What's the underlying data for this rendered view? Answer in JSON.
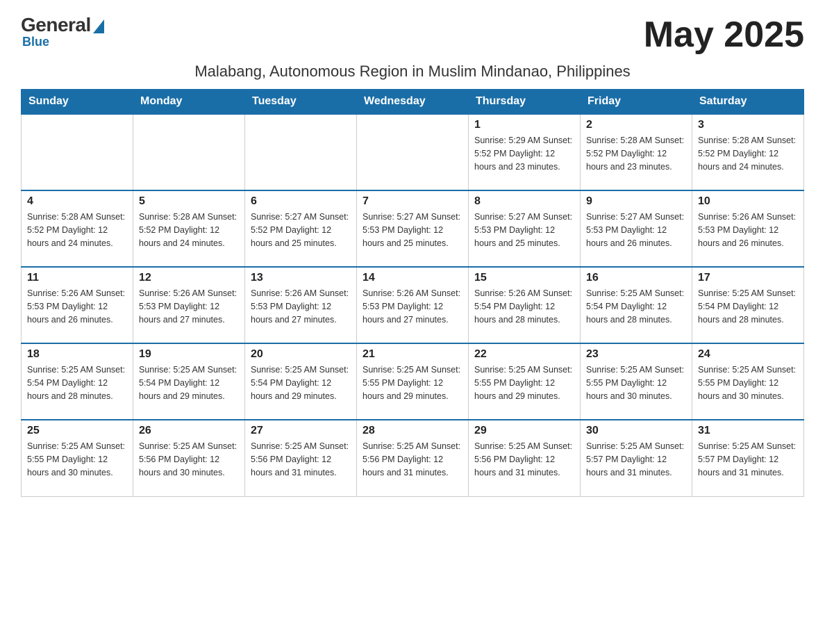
{
  "header": {
    "logo_general": "General",
    "logo_blue": "Blue",
    "month_year": "May 2025",
    "location": "Malabang, Autonomous Region in Muslim Mindanao, Philippines"
  },
  "weekdays": [
    "Sunday",
    "Monday",
    "Tuesday",
    "Wednesday",
    "Thursday",
    "Friday",
    "Saturday"
  ],
  "weeks": [
    [
      {
        "day": "",
        "info": ""
      },
      {
        "day": "",
        "info": ""
      },
      {
        "day": "",
        "info": ""
      },
      {
        "day": "",
        "info": ""
      },
      {
        "day": "1",
        "info": "Sunrise: 5:29 AM\nSunset: 5:52 PM\nDaylight: 12 hours\nand 23 minutes."
      },
      {
        "day": "2",
        "info": "Sunrise: 5:28 AM\nSunset: 5:52 PM\nDaylight: 12 hours\nand 23 minutes."
      },
      {
        "day": "3",
        "info": "Sunrise: 5:28 AM\nSunset: 5:52 PM\nDaylight: 12 hours\nand 24 minutes."
      }
    ],
    [
      {
        "day": "4",
        "info": "Sunrise: 5:28 AM\nSunset: 5:52 PM\nDaylight: 12 hours\nand 24 minutes."
      },
      {
        "day": "5",
        "info": "Sunrise: 5:28 AM\nSunset: 5:52 PM\nDaylight: 12 hours\nand 24 minutes."
      },
      {
        "day": "6",
        "info": "Sunrise: 5:27 AM\nSunset: 5:52 PM\nDaylight: 12 hours\nand 25 minutes."
      },
      {
        "day": "7",
        "info": "Sunrise: 5:27 AM\nSunset: 5:53 PM\nDaylight: 12 hours\nand 25 minutes."
      },
      {
        "day": "8",
        "info": "Sunrise: 5:27 AM\nSunset: 5:53 PM\nDaylight: 12 hours\nand 25 minutes."
      },
      {
        "day": "9",
        "info": "Sunrise: 5:27 AM\nSunset: 5:53 PM\nDaylight: 12 hours\nand 26 minutes."
      },
      {
        "day": "10",
        "info": "Sunrise: 5:26 AM\nSunset: 5:53 PM\nDaylight: 12 hours\nand 26 minutes."
      }
    ],
    [
      {
        "day": "11",
        "info": "Sunrise: 5:26 AM\nSunset: 5:53 PM\nDaylight: 12 hours\nand 26 minutes."
      },
      {
        "day": "12",
        "info": "Sunrise: 5:26 AM\nSunset: 5:53 PM\nDaylight: 12 hours\nand 27 minutes."
      },
      {
        "day": "13",
        "info": "Sunrise: 5:26 AM\nSunset: 5:53 PM\nDaylight: 12 hours\nand 27 minutes."
      },
      {
        "day": "14",
        "info": "Sunrise: 5:26 AM\nSunset: 5:53 PM\nDaylight: 12 hours\nand 27 minutes."
      },
      {
        "day": "15",
        "info": "Sunrise: 5:26 AM\nSunset: 5:54 PM\nDaylight: 12 hours\nand 28 minutes."
      },
      {
        "day": "16",
        "info": "Sunrise: 5:25 AM\nSunset: 5:54 PM\nDaylight: 12 hours\nand 28 minutes."
      },
      {
        "day": "17",
        "info": "Sunrise: 5:25 AM\nSunset: 5:54 PM\nDaylight: 12 hours\nand 28 minutes."
      }
    ],
    [
      {
        "day": "18",
        "info": "Sunrise: 5:25 AM\nSunset: 5:54 PM\nDaylight: 12 hours\nand 28 minutes."
      },
      {
        "day": "19",
        "info": "Sunrise: 5:25 AM\nSunset: 5:54 PM\nDaylight: 12 hours\nand 29 minutes."
      },
      {
        "day": "20",
        "info": "Sunrise: 5:25 AM\nSunset: 5:54 PM\nDaylight: 12 hours\nand 29 minutes."
      },
      {
        "day": "21",
        "info": "Sunrise: 5:25 AM\nSunset: 5:55 PM\nDaylight: 12 hours\nand 29 minutes."
      },
      {
        "day": "22",
        "info": "Sunrise: 5:25 AM\nSunset: 5:55 PM\nDaylight: 12 hours\nand 29 minutes."
      },
      {
        "day": "23",
        "info": "Sunrise: 5:25 AM\nSunset: 5:55 PM\nDaylight: 12 hours\nand 30 minutes."
      },
      {
        "day": "24",
        "info": "Sunrise: 5:25 AM\nSunset: 5:55 PM\nDaylight: 12 hours\nand 30 minutes."
      }
    ],
    [
      {
        "day": "25",
        "info": "Sunrise: 5:25 AM\nSunset: 5:55 PM\nDaylight: 12 hours\nand 30 minutes."
      },
      {
        "day": "26",
        "info": "Sunrise: 5:25 AM\nSunset: 5:56 PM\nDaylight: 12 hours\nand 30 minutes."
      },
      {
        "day": "27",
        "info": "Sunrise: 5:25 AM\nSunset: 5:56 PM\nDaylight: 12 hours\nand 31 minutes."
      },
      {
        "day": "28",
        "info": "Sunrise: 5:25 AM\nSunset: 5:56 PM\nDaylight: 12 hours\nand 31 minutes."
      },
      {
        "day": "29",
        "info": "Sunrise: 5:25 AM\nSunset: 5:56 PM\nDaylight: 12 hours\nand 31 minutes."
      },
      {
        "day": "30",
        "info": "Sunrise: 5:25 AM\nSunset: 5:57 PM\nDaylight: 12 hours\nand 31 minutes."
      },
      {
        "day": "31",
        "info": "Sunrise: 5:25 AM\nSunset: 5:57 PM\nDaylight: 12 hours\nand 31 minutes."
      }
    ]
  ]
}
